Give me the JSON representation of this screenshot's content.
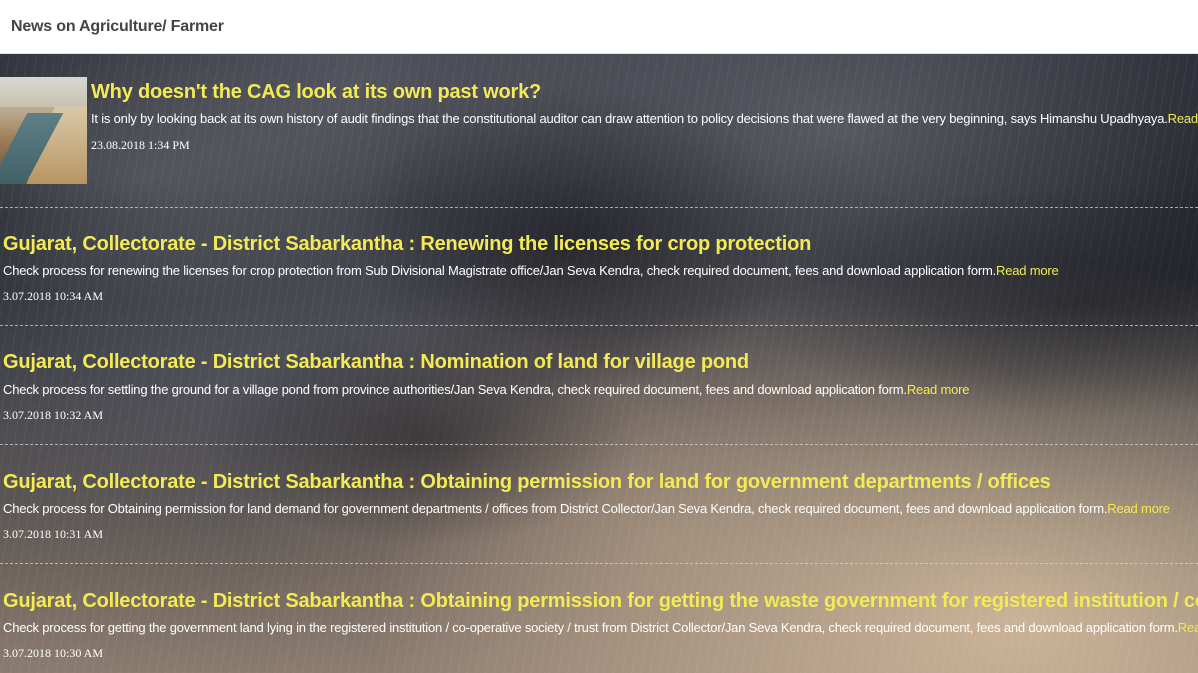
{
  "header": {
    "title": "News on Agriculture/ Farmer"
  },
  "news": [
    {
      "title": "Why doesn't the CAG look at its own past work?",
      "description": "It is only by looking back at its own history of audit findings that the constitutional auditor can draw attention to policy decisions that were flawed at the very beginning, says Himanshu Upadhyaya.",
      "read_more": "Read more",
      "date": "23.08.2018 1:34 PM",
      "has_thumbnail": true
    },
    {
      "title": "Gujarat, Collectorate - District Sabarkantha : Renewing the licenses for crop protection",
      "description": "Check process for renewing the licenses for crop protection from Sub Divisional Magistrate office/Jan Seva Kendra, check required document, fees and download application form.",
      "read_more": "Read more",
      "date": "3.07.2018 10:34 AM",
      "has_thumbnail": false
    },
    {
      "title": "Gujarat, Collectorate - District Sabarkantha : Nomination of land for village pond",
      "description": "Check process for settling the ground for a village pond from province authorities/Jan Seva Kendra, check required document, fees and download application form.",
      "read_more": "Read more",
      "date": "3.07.2018 10:32 AM",
      "has_thumbnail": false
    },
    {
      "title": "Gujarat, Collectorate - District Sabarkantha : Obtaining permission for land for government departments / offices",
      "description": "Check process for Obtaining permission for land demand for government departments / offices from District Collector/Jan Seva Kendra, check required document, fees and download application form.",
      "read_more": "Read more",
      "date": "3.07.2018 10:31 AM",
      "has_thumbnail": false
    },
    {
      "title": "Gujarat, Collectorate - District Sabarkantha : Obtaining permission for getting the waste government for registered institution / co-operative society / trust",
      "description": "Check process for getting the government land lying in the registered institution / co-operative society / trust from District Collector/Jan Seva Kendra, check required document, fees and download application form.",
      "read_more": "Read more",
      "date": "3.07.2018 10:30 AM",
      "has_thumbnail": false
    }
  ],
  "colors": {
    "title": "#f3ea55",
    "text": "#ffffff",
    "header_bg": "#ffffff",
    "header_text": "#444444"
  }
}
